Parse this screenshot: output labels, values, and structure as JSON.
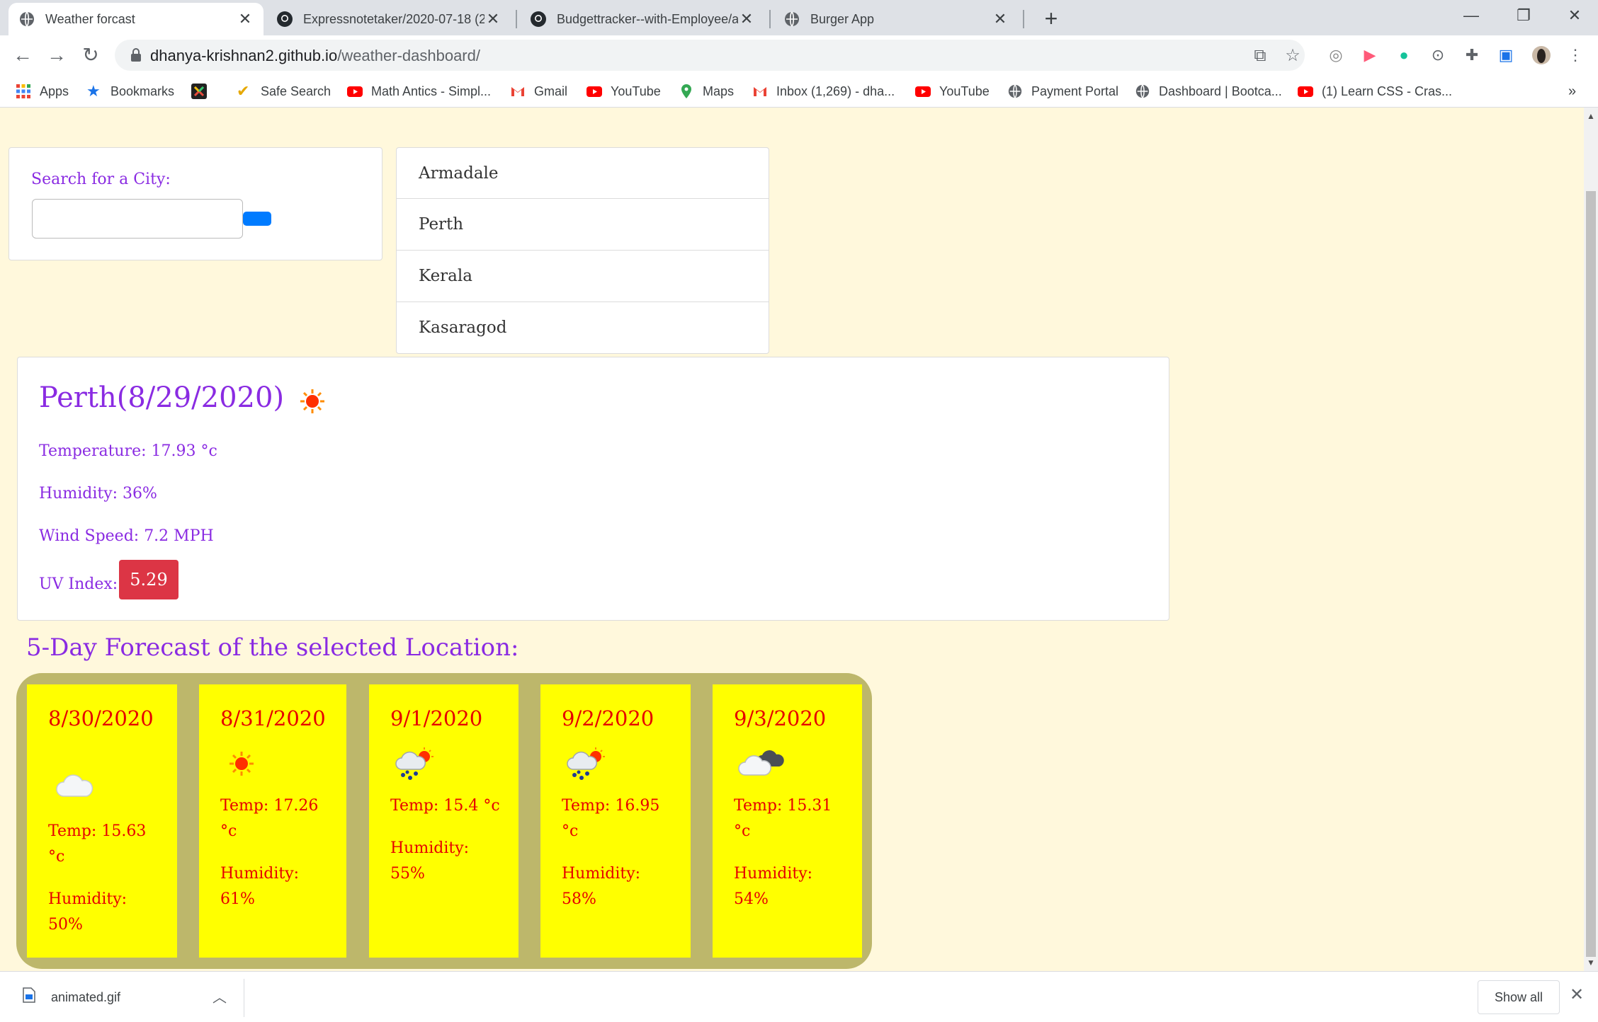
{
  "browser": {
    "tabs": [
      {
        "title": "Weather forcast",
        "active": true
      },
      {
        "title": "Expressnotetaker/2020-07-18 (2)",
        "active": false
      },
      {
        "title": "Budgettracker--with-Employee/a",
        "active": false
      },
      {
        "title": "Burger App",
        "active": false
      }
    ],
    "url_host": "dhanya-krishnan2.github.io",
    "url_path": "/weather-dashboard/",
    "bookmarks": [
      "Apps",
      "Bookmarks",
      "",
      "Safe Search",
      "Math Antics - Simpl...",
      "Gmail",
      "YouTube",
      "Maps",
      "Inbox (1,269) - dha...",
      "YouTube",
      "Payment Portal",
      "Dashboard | Bootca...",
      "(1) Learn CSS - Cras..."
    ],
    "bookmarks_overflow": "»"
  },
  "search": {
    "label": "Search for a City:",
    "value": "",
    "placeholder": ""
  },
  "cities": [
    "Armadale",
    "Perth",
    "Kerala",
    "Kasaragod"
  ],
  "current": {
    "title": "Perth(8/29/2020)",
    "icon": "sun-icon",
    "temperature": "Temperature: 17.93 °c",
    "humidity": "Humidity: 36%",
    "wind": "Wind Speed: 7.2 MPH",
    "uv_label": "UV Index:",
    "uv_value": "5.29",
    "uv_color": "#dc3545"
  },
  "forecast": {
    "heading": "5-Day Forecast of the selected Location:",
    "days": [
      {
        "date": "8/30/2020",
        "icon": "cloud-icon",
        "temp": "Temp: 15.63 °c",
        "humidity": "Humidity: 50%"
      },
      {
        "date": "8/31/2020",
        "icon": "sun-icon",
        "temp": "Temp: 17.26 °c",
        "humidity": "Humidity: 61%"
      },
      {
        "date": "9/1/2020",
        "icon": "rain-sun-icon",
        "temp": "Temp: 15.4 °c",
        "humidity": "Humidity: 55%"
      },
      {
        "date": "9/2/2020",
        "icon": "rain-sun-icon",
        "temp": "Temp: 16.95 °c",
        "humidity": "Humidity: 58%"
      },
      {
        "date": "9/3/2020",
        "icon": "cloudy-icon",
        "temp": "Temp: 15.31 °c",
        "humidity": "Humidity: 54%"
      }
    ]
  },
  "downloads": {
    "file": "animated.gif",
    "show_all": "Show all"
  },
  "colors": {
    "page_bg": "#fff8dc",
    "accent_text": "#8a2be2",
    "forecast_bg": "#bdb76b",
    "forecast_card": "#ffff00",
    "forecast_text": "#e60000",
    "search_button": "#007bff"
  }
}
